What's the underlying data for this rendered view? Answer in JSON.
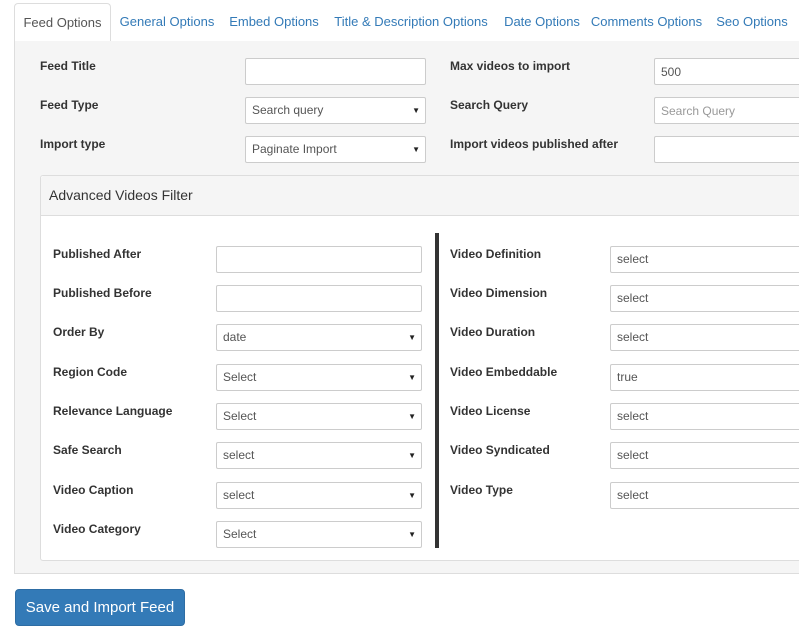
{
  "tabs": [
    {
      "label": "Feed Options"
    },
    {
      "label": "General Options"
    },
    {
      "label": "Embed Options"
    },
    {
      "label": "Title & Description Options"
    },
    {
      "label": "Date Options"
    },
    {
      "label": "Comments Options"
    },
    {
      "label": "Seo Options"
    }
  ],
  "form": {
    "feed_title": {
      "label": "Feed Title",
      "value": ""
    },
    "max_videos": {
      "label": "Max videos to import",
      "value": "500"
    },
    "feed_type": {
      "label": "Feed Type",
      "value": "Search query"
    },
    "search_query": {
      "label": "Search Query",
      "placeholder": "Search Query",
      "value": ""
    },
    "import_type": {
      "label": "Import type",
      "value": "Paginate Import"
    },
    "published_after_import": {
      "label": "Import videos published after",
      "value": ""
    }
  },
  "advanced": {
    "title": "Advanced Videos Filter",
    "published_after": {
      "label": "Published After",
      "value": ""
    },
    "published_before": {
      "label": "Published Before",
      "value": ""
    },
    "order_by": {
      "label": "Order By",
      "value": "date"
    },
    "region_code": {
      "label": "Region Code",
      "value": "Select"
    },
    "relevance_language": {
      "label": "Relevance Language",
      "value": "Select"
    },
    "safe_search": {
      "label": "Safe Search",
      "value": "select"
    },
    "video_caption": {
      "label": "Video Caption",
      "value": "select"
    },
    "video_category": {
      "label": "Video Category",
      "value": "Select"
    },
    "video_definition": {
      "label": "Video Definition",
      "value": "select"
    },
    "video_dimension": {
      "label": "Video Dimension",
      "value": "select"
    },
    "video_duration": {
      "label": "Video Duration",
      "value": "select"
    },
    "video_embeddable": {
      "label": "Video Embeddable",
      "value": "true"
    },
    "video_license": {
      "label": "Video License",
      "value": "select"
    },
    "video_syndicated": {
      "label": "Video Syndicated",
      "value": "select"
    },
    "video_type": {
      "label": "Video Type",
      "value": "select"
    }
  },
  "save_button": {
    "label": "Save and Import Feed"
  },
  "icons": {
    "dropdown_arrow": "▼"
  },
  "colors": {
    "primary": "#337ab7",
    "link": "#337ab7",
    "panel_bg": "#f5f5f5"
  }
}
